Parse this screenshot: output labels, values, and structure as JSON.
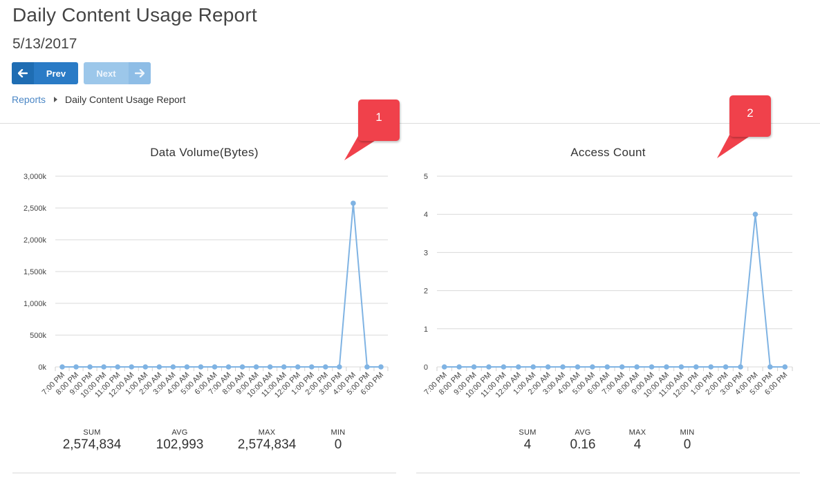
{
  "header": {
    "title": "Daily Content Usage Report",
    "date": "5/13/2017"
  },
  "nav": {
    "prev_label": "Prev",
    "next_label": "Next",
    "prev_icon": "arrow-left-icon",
    "next_icon": "arrow-right-icon"
  },
  "breadcrumb": {
    "root": "Reports",
    "current": "Daily Content Usage Report"
  },
  "callouts": [
    "1",
    "2"
  ],
  "colors": {
    "line": "#7fb3e3",
    "primary_button": "#2a7bc6",
    "disabled_button": "#9cc7ea",
    "callout": "#f0414b",
    "link": "#4a86c5"
  },
  "chart_data": [
    {
      "type": "line",
      "title": "Data Volume(Bytes)",
      "x": [
        "7:00 PM",
        "8:00 PM",
        "9:00 PM",
        "10:00 PM",
        "11:00 PM",
        "12:00 AM",
        "1:00 AM",
        "2:00 AM",
        "3:00 AM",
        "4:00 AM",
        "5:00 AM",
        "6:00 AM",
        "7:00 AM",
        "8:00 AM",
        "9:00 AM",
        "10:00 AM",
        "11:00 AM",
        "12:00 PM",
        "1:00 PM",
        "2:00 PM",
        "3:00 PM",
        "4:00 PM",
        "5:00 PM",
        "6:00 PM"
      ],
      "series": [
        {
          "values": [
            0,
            0,
            0,
            0,
            0,
            0,
            0,
            0,
            0,
            0,
            0,
            0,
            0,
            0,
            0,
            0,
            0,
            0,
            0,
            0,
            0,
            2574834,
            0,
            0
          ]
        }
      ],
      "ylim": [
        0,
        3000000
      ],
      "yticks": [
        0,
        500000,
        1000000,
        1500000,
        2000000,
        2500000,
        3000000
      ],
      "ytick_labels": [
        "0k",
        "500k",
        "1,000k",
        "1,500k",
        "2,000k",
        "2,500k",
        "3,000k"
      ],
      "grid": true,
      "stats": [
        {
          "label": "SUM",
          "value": "2,574,834"
        },
        {
          "label": "AVG",
          "value": "102,993"
        },
        {
          "label": "MAX",
          "value": "2,574,834"
        },
        {
          "label": "MIN",
          "value": "0"
        }
      ]
    },
    {
      "type": "line",
      "title": "Access Count",
      "x": [
        "7:00 PM",
        "8:00 PM",
        "9:00 PM",
        "10:00 PM",
        "11:00 PM",
        "12:00 AM",
        "1:00 AM",
        "2:00 AM",
        "3:00 AM",
        "4:00 AM",
        "5:00 AM",
        "6:00 AM",
        "7:00 AM",
        "8:00 AM",
        "9:00 AM",
        "10:00 AM",
        "11:00 AM",
        "12:00 PM",
        "1:00 PM",
        "2:00 PM",
        "3:00 PM",
        "4:00 PM",
        "5:00 PM",
        "6:00 PM"
      ],
      "series": [
        {
          "values": [
            0,
            0,
            0,
            0,
            0,
            0,
            0,
            0,
            0,
            0,
            0,
            0,
            0,
            0,
            0,
            0,
            0,
            0,
            0,
            0,
            0,
            4,
            0,
            0
          ]
        }
      ],
      "ylim": [
        0,
        5
      ],
      "yticks": [
        0,
        1,
        2,
        3,
        4,
        5
      ],
      "ytick_labels": [
        "0",
        "1",
        "2",
        "3",
        "4",
        "5"
      ],
      "grid": true,
      "stats": [
        {
          "label": "SUM",
          "value": "4"
        },
        {
          "label": "AVG",
          "value": "0.16"
        },
        {
          "label": "MAX",
          "value": "4"
        },
        {
          "label": "MIN",
          "value": "0"
        }
      ]
    }
  ]
}
